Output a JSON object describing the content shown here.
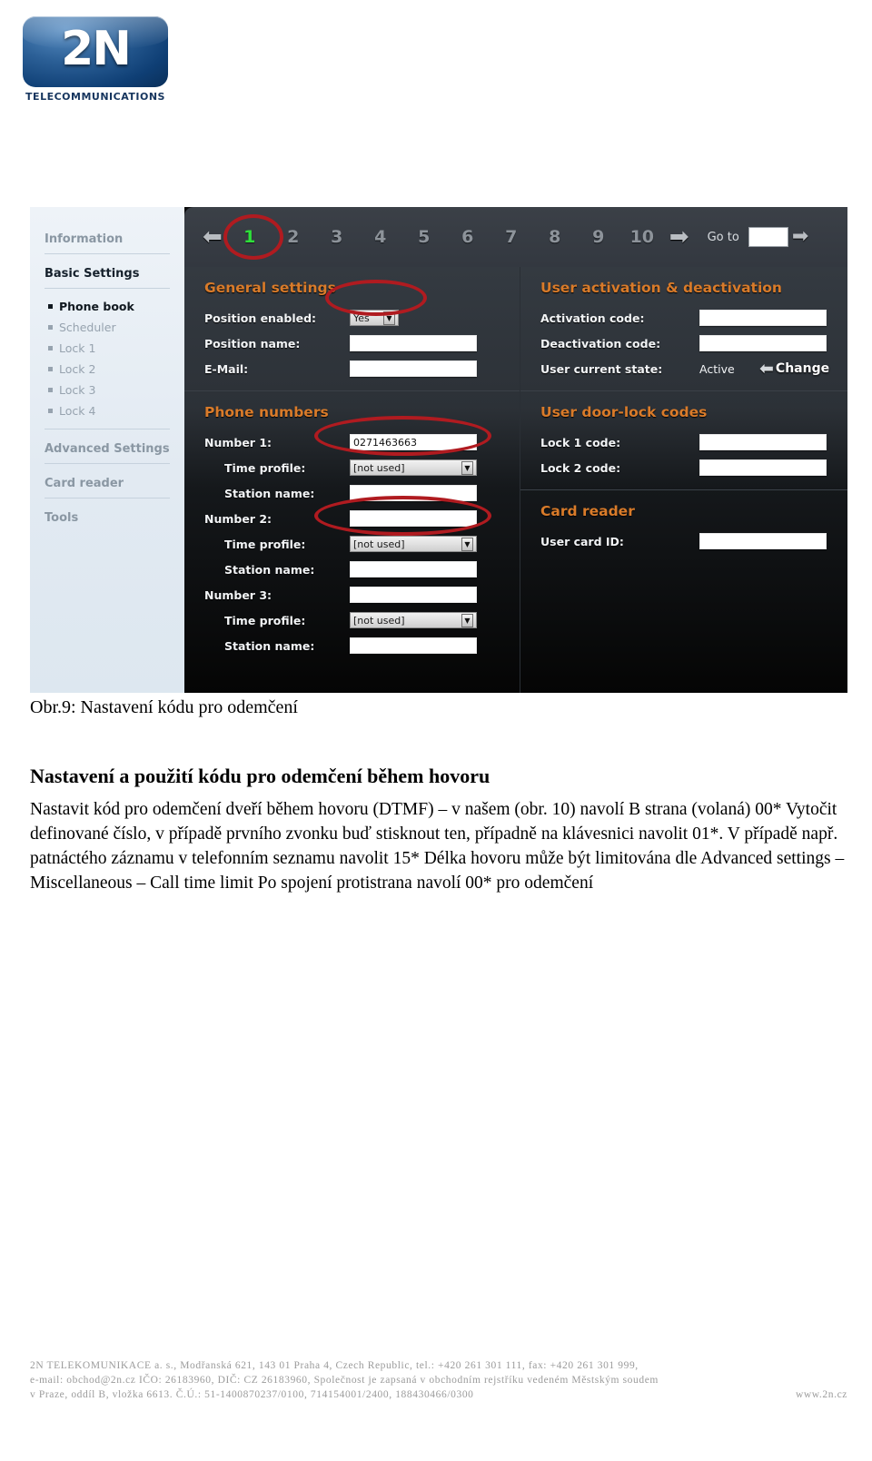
{
  "logo": {
    "mark": "2N",
    "caption": "TELECOMMUNICATIONS"
  },
  "screenshot": {
    "sidebar": {
      "items": [
        {
          "label": "Information",
          "type": "head",
          "active": false
        },
        {
          "label": "Basic Settings",
          "type": "head",
          "active": true
        },
        {
          "label": "Phone book",
          "type": "sub",
          "active": true
        },
        {
          "label": "Scheduler",
          "type": "sub",
          "active": false
        },
        {
          "label": "Lock 1",
          "type": "sub",
          "active": false
        },
        {
          "label": "Lock 2",
          "type": "sub",
          "active": false
        },
        {
          "label": "Lock 3",
          "type": "sub",
          "active": false
        },
        {
          "label": "Lock 4",
          "type": "sub",
          "active": false
        },
        {
          "label": "Advanced Settings",
          "type": "head",
          "active": false
        },
        {
          "label": "Card reader",
          "type": "head",
          "active": false
        },
        {
          "label": "Tools",
          "type": "head",
          "active": false
        }
      ]
    },
    "pager": {
      "prev_icon": "left-arrow-icon",
      "next_icon": "right-arrow-icon",
      "pages": [
        "1",
        "2",
        "3",
        "4",
        "5",
        "6",
        "7",
        "8",
        "9",
        "10"
      ],
      "current_page": "1",
      "current_page_color": "#2ee03a",
      "goto_label": "Go to",
      "goto_value": "",
      "goto_icon": "right-arrow-icon"
    },
    "general_settings": {
      "title": "General settings",
      "position_enabled": {
        "label": "Position enabled:",
        "value": "Yes"
      },
      "position_name": {
        "label": "Position name:",
        "value": ""
      },
      "email": {
        "label": "E-Mail:",
        "value": ""
      }
    },
    "phone_numbers": {
      "title": "Phone numbers",
      "entries": [
        {
          "number_label": "Number 1:",
          "number_value": "0271463663",
          "time_profile_label": "Time profile:",
          "time_profile_value": "[not used]",
          "station_name_label": "Station name:",
          "station_name_value": ""
        },
        {
          "number_label": "Number 2:",
          "number_value": "",
          "time_profile_label": "Time profile:",
          "time_profile_value": "[not used]",
          "station_name_label": "Station name:",
          "station_name_value": ""
        },
        {
          "number_label": "Number 3:",
          "number_value": "",
          "time_profile_label": "Time profile:",
          "time_profile_value": "[not used]",
          "station_name_label": "Station name:",
          "station_name_value": ""
        }
      ]
    },
    "user_activation": {
      "title": "User activation & deactivation",
      "activation_code": {
        "label": "Activation code:",
        "value": ""
      },
      "deactivation_code": {
        "label": "Deactivation code:",
        "value": ""
      },
      "current_state": {
        "label": "User current state:",
        "value": "Active",
        "change_label": "Change"
      }
    },
    "door_lock_codes": {
      "title": "User door-lock codes",
      "lock1": {
        "label": "Lock 1 code:",
        "value": ""
      },
      "lock2": {
        "label": "Lock 2 code:",
        "value": ""
      }
    },
    "card_reader": {
      "title": "Card reader",
      "user_card_id": {
        "label": "User card ID:",
        "value": ""
      }
    },
    "annotation_color": "#b01b20"
  },
  "document": {
    "figure_caption": "Obr.9: Nastavení kódu pro odemčení",
    "heading": "Nastavení a použití kódu pro odemčení během hovoru",
    "paragraph": "Nastavit kód pro odemčení dveří během hovoru (DTMF) – v našem (obr. 10) navolí B strana (volaná) 00* Vytočit definované číslo, v případě prvního zvonku buď stisknout ten, případně na klávesnici navolit 01*. V případě např. patnáctého záznamu v telefonním seznamu navolit 15* Délka hovoru může být limitována dle Advanced settings – Miscellaneous – Call time limit Po spojení protistrana navolí 00* pro odemčení"
  },
  "footer": {
    "line1": "2N TELEKOMUNIKACE a. s., Modřanská 621, 143 01 Praha 4, Czech Republic, tel.: +420 261 301 111, fax: +420 261 301 999,",
    "line2": "e-mail: obchod@2n.cz  IČO: 26183960, DIČ: CZ 26183960, Společnost je zapsaná v obchodním rejstříku vedeném Městským soudem",
    "line3a": "v Praze, oddíl B, vložka 6613. Č.Ú.: 51-1400870237/0100, 714154001/2400,  188430466/0300",
    "line3b": "www.2n.cz"
  }
}
